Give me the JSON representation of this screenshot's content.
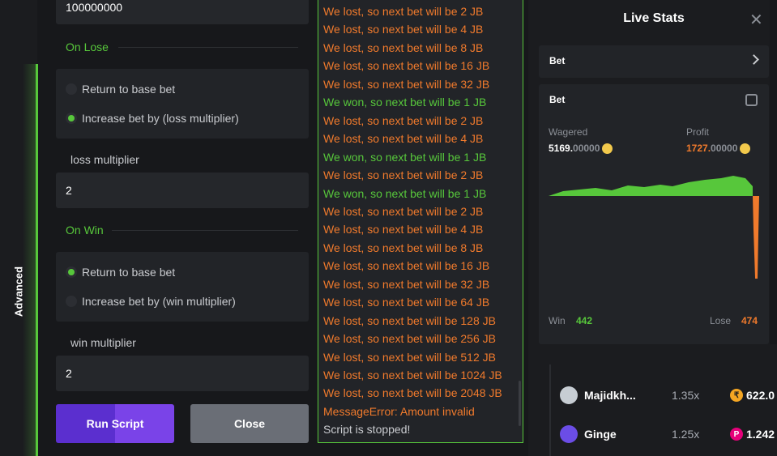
{
  "sidebar": {
    "tab_label": "Advanced"
  },
  "form": {
    "base_value": "100000000",
    "on_lose": {
      "heading": "On Lose",
      "options": [
        "Return to base bet",
        "Increase bet by (loss multiplier)"
      ],
      "selected_index": 1,
      "multiplier_label": "loss multiplier",
      "multiplier_value": "2"
    },
    "on_win": {
      "heading": "On Win",
      "options": [
        "Return to base bet",
        "Increase bet by (win multiplier)"
      ],
      "selected_index": 0,
      "multiplier_label": "win multiplier",
      "multiplier_value": "2"
    },
    "run_label": "Run Script",
    "close_label": "Close"
  },
  "log": [
    {
      "text": "We lost, so next bet will be 2 JB",
      "type": "lost"
    },
    {
      "text": "We lost, so next bet will be 4 JB",
      "type": "lost"
    },
    {
      "text": "We lost, so next bet will be 8 JB",
      "type": "lost"
    },
    {
      "text": "We lost, so next bet will be 16 JB",
      "type": "lost"
    },
    {
      "text": "We lost, so next bet will be 32 JB",
      "type": "lost"
    },
    {
      "text": "We won, so next bet will be 1 JB",
      "type": "won"
    },
    {
      "text": "We lost, so next bet will be 2 JB",
      "type": "lost"
    },
    {
      "text": "We lost, so next bet will be 4 JB",
      "type": "lost"
    },
    {
      "text": "We won, so next bet will be 1 JB",
      "type": "won"
    },
    {
      "text": "We lost, so next bet will be 2 JB",
      "type": "lost"
    },
    {
      "text": "We won, so next bet will be 1 JB",
      "type": "won"
    },
    {
      "text": "We lost, so next bet will be 2 JB",
      "type": "lost"
    },
    {
      "text": "We lost, so next bet will be 4 JB",
      "type": "lost"
    },
    {
      "text": "We lost, so next bet will be 8 JB",
      "type": "lost"
    },
    {
      "text": "We lost, so next bet will be 16 JB",
      "type": "lost"
    },
    {
      "text": "We lost, so next bet will be 32 JB",
      "type": "lost"
    },
    {
      "text": "We lost, so next bet will be 64 JB",
      "type": "lost"
    },
    {
      "text": "We lost, so next bet will be 128 JB",
      "type": "lost"
    },
    {
      "text": "We lost, so next bet will be 256 JB",
      "type": "lost"
    },
    {
      "text": "We lost, so next bet will be 512 JB",
      "type": "lost"
    },
    {
      "text": "We lost, so next bet will be 1024 JB",
      "type": "lost"
    },
    {
      "text": "We lost, so next bet will be 2048 JB",
      "type": "lost"
    },
    {
      "text": "MessageError: Amount invalid",
      "type": "lost"
    },
    {
      "text": "Script is stopped!",
      "type": "plain"
    }
  ],
  "stats": {
    "title": "Live Stats",
    "bet_bar_label": "Bet",
    "card_label": "Bet",
    "wagered_label": "Wagered",
    "wagered_int": "5169.",
    "wagered_dec": "00000",
    "profit_label": "Profit",
    "profit_int": "1727.",
    "profit_dec": "00000",
    "win_label": "Win",
    "win_count": "442",
    "lose_label": "Lose",
    "lose_count": "474",
    "colors": {
      "accent": "#57c73b",
      "loss": "#f07a2c",
      "coin": "#f2c94c"
    }
  },
  "players": [
    {
      "name": "Majidkh...",
      "multiplier": "1.35x",
      "amount": "622.0",
      "coin_icon": "rupee-coin-icon",
      "coin_symbol": "₹",
      "coin_color": "#f5a623"
    },
    {
      "name": "Ginge",
      "multiplier": "1.25x",
      "amount": "1.242",
      "coin_icon": "polkadot-coin-icon",
      "coin_symbol": "P",
      "coin_color": "#e6007a"
    }
  ]
}
